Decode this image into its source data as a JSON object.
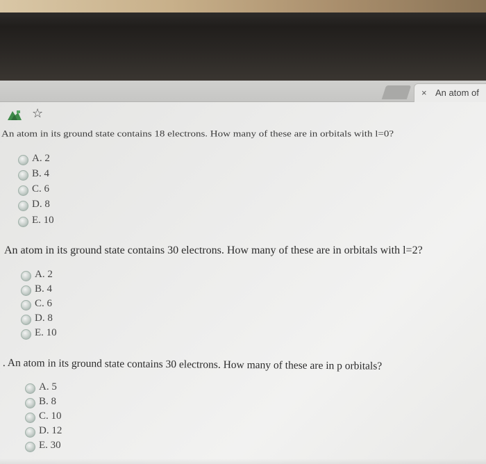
{
  "browser": {
    "tab_title": "An atom of",
    "tab_close": "×"
  },
  "toolbar": {
    "star": "☆"
  },
  "questions": [
    {
      "text": "An atom in its ground state contains 18 electrons. How many of these are in orbitals with l=0?",
      "options": [
        "A. 2",
        "B. 4",
        "C. 6",
        "D. 8",
        "E. 10"
      ]
    },
    {
      "text": "An atom in its ground state contains 30 electrons. How many of these are in orbitals with l=2?",
      "options": [
        "A. 2",
        "B. 4",
        "C. 6",
        "D. 8",
        "E. 10"
      ]
    },
    {
      "text": ". An atom in its ground state contains 30 electrons. How many of these are in p orbitals?",
      "options": [
        "A. 5",
        "B. 8",
        "C. 10",
        "D. 12",
        "E. 30"
      ]
    }
  ],
  "colors": {
    "radio": "#cfd6d2",
    "text": "#2b2b2b"
  },
  "icons": {
    "app": "green-app-icon",
    "bookmark": "star-icon",
    "close": "close-icon"
  }
}
